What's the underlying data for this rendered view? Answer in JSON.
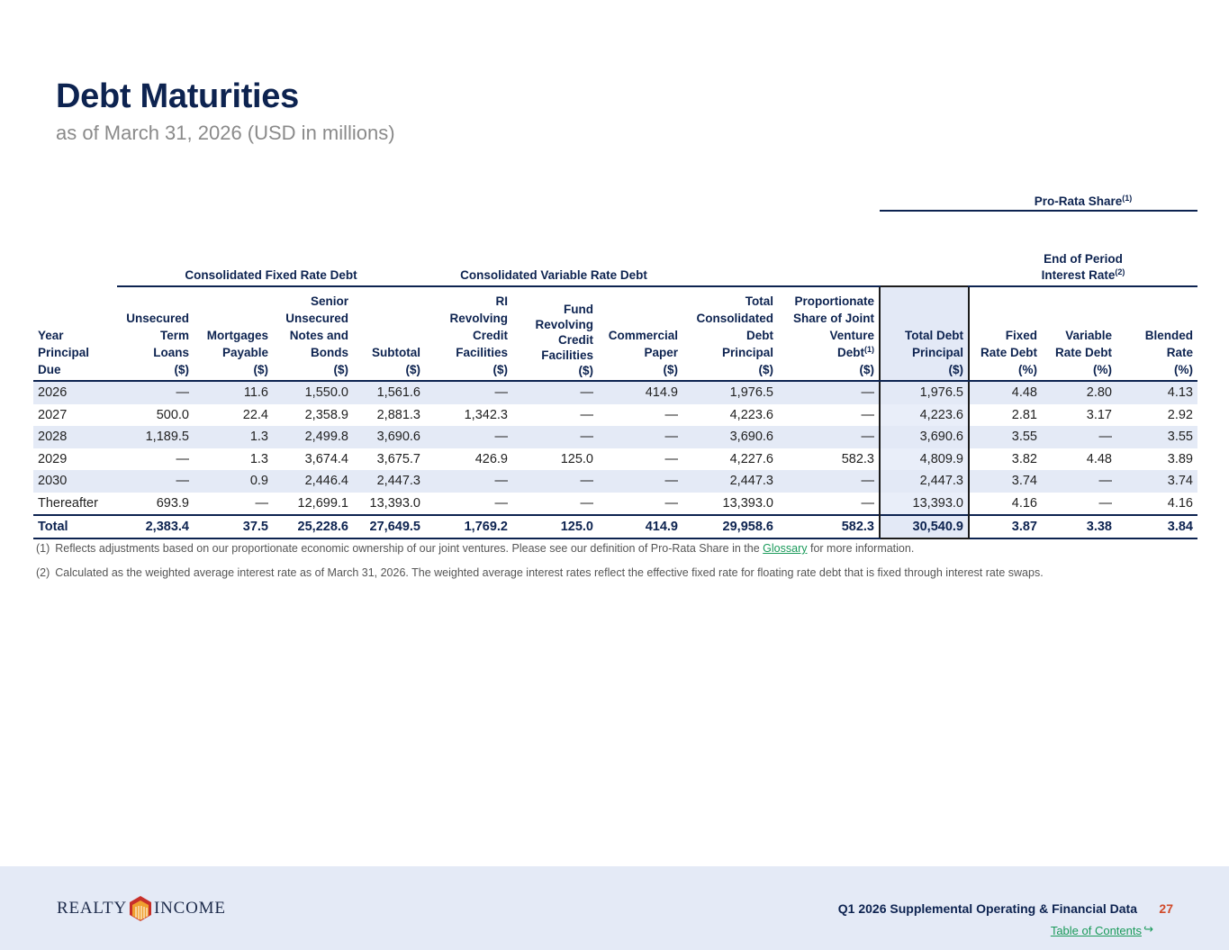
{
  "page": {
    "title": "Debt Maturities",
    "subtitle": "as of March 31, 2026 (USD in millions)"
  },
  "table": {
    "pro_rata_label": "Pro-Rata Share",
    "pro_rata_sup": "(1)",
    "groups": {
      "fixed": "Consolidated Fixed Rate Debt",
      "variable": "Consolidated Variable Rate Debt",
      "interest_line1": "End of Period",
      "interest_line2": "Interest Rate",
      "interest_sup": "(2)"
    },
    "headers": {
      "year": [
        "Year",
        "Principal",
        "Due"
      ],
      "unsecured_term": [
        "Unsecured",
        "Term",
        "Loans",
        "($)"
      ],
      "mortgages": [
        "Mortgages",
        "Payable",
        "($)"
      ],
      "senior_notes": [
        "Senior",
        "Unsecured",
        "Notes and",
        "Bonds",
        "($)"
      ],
      "subtotal": [
        "Subtotal",
        "($)"
      ],
      "ri_revolving": [
        "RI",
        "Revolving",
        "Credit",
        "Facilities",
        "($)"
      ],
      "fund_revolving": [
        "Fund",
        "Revolving",
        "Credit",
        "Facilities",
        "($)"
      ],
      "commercial_paper": [
        "Commercial",
        "Paper",
        "($)"
      ],
      "total_consolidated": [
        "Total",
        "Consolidated",
        "Debt",
        "Principal",
        "($)"
      ],
      "proportionate_jv": [
        "Proportionate",
        "Share of Joint",
        "Venture",
        "Debt",
        "($)"
      ],
      "proportionate_sup": "(1)",
      "total_debt": [
        "Total Debt",
        "Principal",
        "($)"
      ],
      "fixed_rate": [
        "Fixed",
        "Rate Debt",
        "(%)"
      ],
      "variable_rate": [
        "Variable",
        "Rate Debt",
        "(%)"
      ],
      "blended_rate": [
        "Blended",
        "Rate",
        "(%)"
      ]
    },
    "rows": [
      [
        "2026",
        "—",
        "11.6",
        "1,550.0",
        "1,561.6",
        "—",
        "—",
        "414.9",
        "1,976.5",
        "—",
        "1,976.5",
        "4.48",
        "2.80",
        "4.13"
      ],
      [
        "2027",
        "500.0",
        "22.4",
        "2,358.9",
        "2,881.3",
        "1,342.3",
        "—",
        "—",
        "4,223.6",
        "—",
        "4,223.6",
        "2.81",
        "3.17",
        "2.92"
      ],
      [
        "2028",
        "1,189.5",
        "1.3",
        "2,499.8",
        "3,690.6",
        "—",
        "—",
        "—",
        "3,690.6",
        "—",
        "3,690.6",
        "3.55",
        "—",
        "3.55"
      ],
      [
        "2029",
        "—",
        "1.3",
        "3,674.4",
        "3,675.7",
        "426.9",
        "125.0",
        "—",
        "4,227.6",
        "582.3",
        "4,809.9",
        "3.82",
        "4.48",
        "3.89"
      ],
      [
        "2030",
        "—",
        "0.9",
        "2,446.4",
        "2,447.3",
        "—",
        "—",
        "—",
        "2,447.3",
        "—",
        "2,447.3",
        "3.74",
        "—",
        "3.74"
      ],
      [
        "Thereafter",
        "693.9",
        "—",
        "12,699.1",
        "13,393.0",
        "—",
        "—",
        "—",
        "13,393.0",
        "—",
        "13,393.0",
        "4.16",
        "—",
        "4.16"
      ]
    ],
    "total": [
      "Total",
      "2,383.4",
      "37.5",
      "25,228.6",
      "27,649.5",
      "1,769.2",
      "125.0",
      "414.9",
      "29,958.6",
      "582.3",
      "30,540.9",
      "3.87",
      "3.38",
      "3.84"
    ]
  },
  "notes": {
    "n1_num": "(1)",
    "n1_text_a": "Reflects adjustments based on our proportionate economic ownership of our joint ventures. Please see our definition of Pro-Rata Share in the",
    "n1_link": "Glossary",
    "n1_text_b": "for more information.",
    "n2_num": "(2)",
    "n2_text": "Calculated as the weighted average interest rate as of March 31, 2026. The weighted average interest rates reflect the effective fixed rate for floating rate debt that is fixed through interest rate swaps."
  },
  "footer": {
    "logo_left": "REALTY",
    "logo_right": "INCOME",
    "title": "Q1 2026 Supplemental Operating & Financial Data",
    "page_number": "27",
    "toc": "Table of Contents",
    "toc_arrow": "↪"
  },
  "colors": {
    "navy": "#0d2350",
    "stripe": "#e4eaf6",
    "link_green": "#1a9a5a",
    "page_number_red": "#d04a2a",
    "logo_orange": "#f0a030"
  }
}
